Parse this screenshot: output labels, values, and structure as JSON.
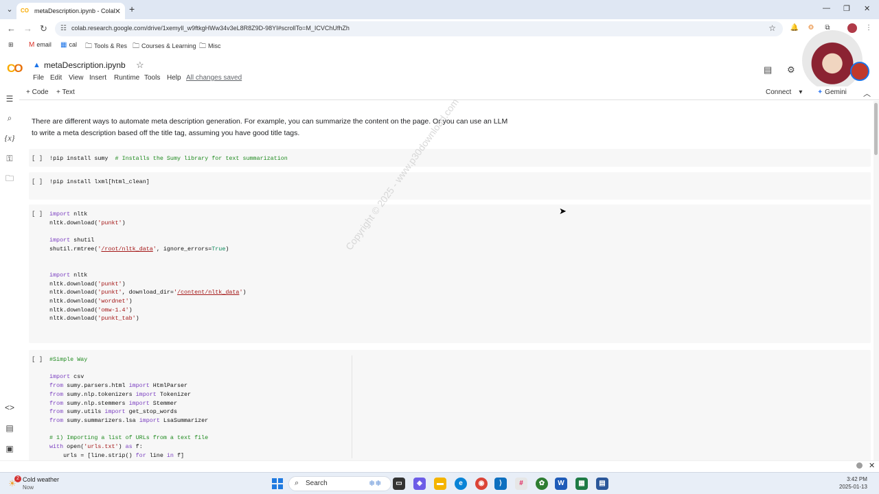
{
  "browser": {
    "tab_title": "metaDescription.ipynb - Colab",
    "url": "colab.research.google.com/drive/1xemyIl_w9ftkgHWw34v3eL8R8Z9D-98YI#scrollTo=M_ICVChUfhZh",
    "new_tab": "+",
    "close": "✕"
  },
  "bookmarks": [
    {
      "label": "email",
      "icon": "gmail-icon"
    },
    {
      "label": "cal",
      "icon": "calendar-icon"
    },
    {
      "label": "Tools & Res",
      "icon": "folder-icon"
    },
    {
      "label": "Courses & Learning",
      "icon": "folder-icon"
    },
    {
      "label": "Misc",
      "icon": "folder-icon"
    }
  ],
  "colab": {
    "logo": "CO",
    "notebook_title": "metaDescription.ipynb",
    "menu": [
      "File",
      "Edit",
      "View",
      "Insert",
      "Runtime",
      "Tools",
      "Help"
    ],
    "save_status": "All changes saved",
    "add_code": "Code",
    "add_text": "Text",
    "connect": "Connect",
    "gemini": "Gemini"
  },
  "cells": {
    "text_1": "There are different ways to automate meta description generation. For example, you can summarize the content on the page. Or you can use an LLM to write a meta description based off the title tag, assuming you have good title tags.",
    "run_marker": "[ ]",
    "code_1_cmd": "!pip install sumy",
    "code_1_comment": "# Installs the Sumy library for text summarization",
    "code_2": "!pip install lxml[html_clean]",
    "code_4_comment1": "#Simple Way",
    "code_4_comment2": "# 1) Importing a list of URLs from a text file"
  },
  "watermark": "Copyright © 2025 - www.p30download.com",
  "taskbar": {
    "weather_title": "Cold weather",
    "weather_sub": "Now",
    "weather_badge": "2",
    "search": "Search",
    "time": "3:42 PM",
    "date": "2025-01-13"
  },
  "colors": {
    "colab_orange": "#f9ab00",
    "keyword": "#7b3fc0",
    "comment": "#1e8a1e",
    "string": "#a31515",
    "link_blue": "#1a73e8"
  }
}
